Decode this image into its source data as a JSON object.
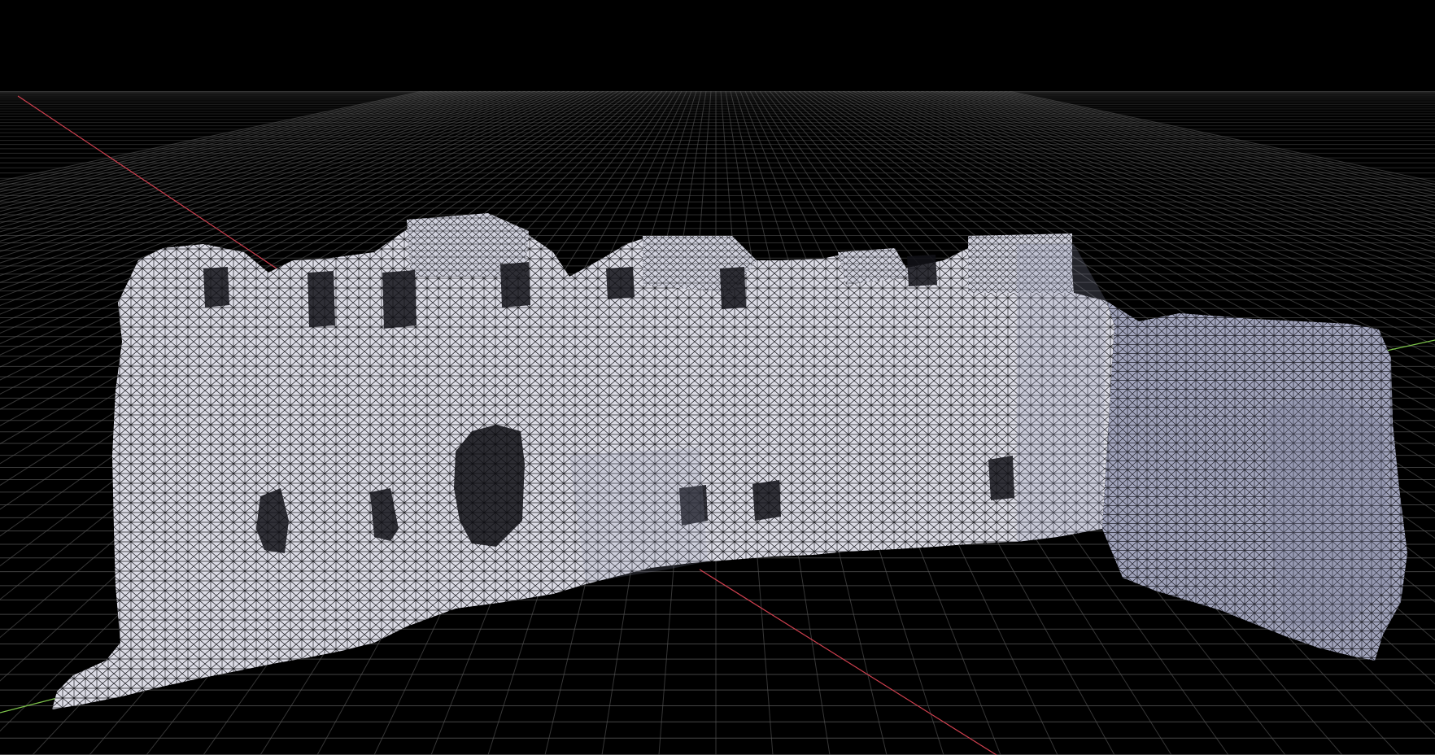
{
  "viewport": {
    "background_color": "#000000",
    "grid_color": "#5a5a5a",
    "grid_major_color": "#787878",
    "axis_x_color": "#d0404f",
    "axis_y_color": "#7cc24a",
    "mesh_fill_color": "#d8d8e2",
    "mesh_shadow_color": "#9a9cb4",
    "mesh_wire_color": "#1a1a1a",
    "opening_color": "#121218"
  },
  "model": {
    "type": "triangulated-mesh-wireframe",
    "subject": "ruined-stone-wall-with-openings",
    "icon": "mesh-object-icon"
  }
}
